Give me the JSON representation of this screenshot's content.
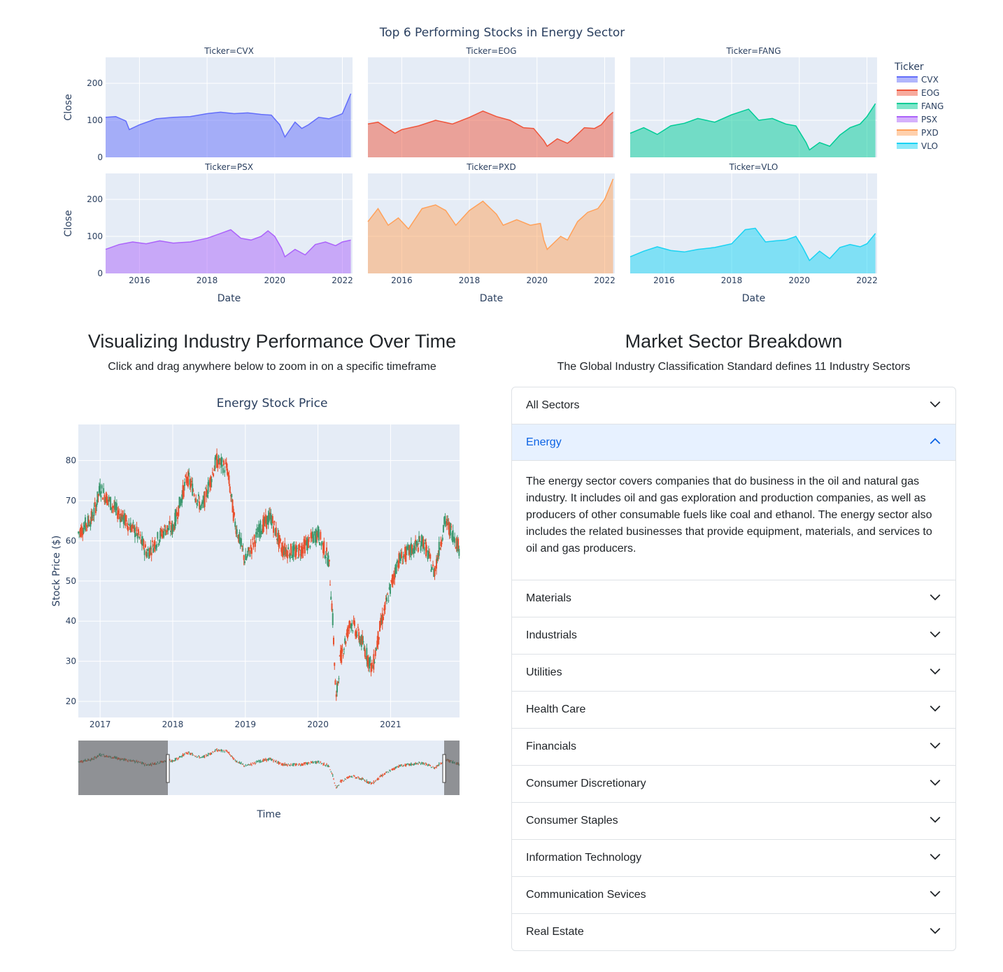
{
  "top": {
    "title": "Top 6 Performing Stocks in Energy Sector",
    "y_axis_label": "Close",
    "x_axis_label": "Date",
    "legend_title": "Ticker"
  },
  "left": {
    "title": "Visualizing Industry Performance Over Time",
    "subtitle": "Click and drag anywhere below to zoom in on a specific timeframe"
  },
  "right": {
    "title": "Market Sector Breakdown",
    "subtitle": "The Global Industry Classification Standard defines 11 Industry Sectors"
  },
  "accordion": {
    "items": [
      {
        "label": "All Sectors",
        "open": false
      },
      {
        "label": "Energy",
        "open": true,
        "body": "The energy sector covers companies that do business in the oil and natural gas industry. It includes oil and gas exploration and production companies, as well as producers of other consumable fuels like coal and ethanol. The energy sector also includes the related businesses that provide equipment, materials, and services to oil and gas producers."
      },
      {
        "label": "Materials",
        "open": false
      },
      {
        "label": "Industrials",
        "open": false
      },
      {
        "label": "Utilities",
        "open": false
      },
      {
        "label": "Health Care",
        "open": false
      },
      {
        "label": "Financials",
        "open": false
      },
      {
        "label": "Consumer Discretionary",
        "open": false
      },
      {
        "label": "Consumer Staples",
        "open": false
      },
      {
        "label": "Information Technology",
        "open": false
      },
      {
        "label": "Communication Sevices",
        "open": false
      },
      {
        "label": "Real Estate",
        "open": false
      }
    ]
  },
  "colors": {
    "plot_bg": "#e5ecf6",
    "accent_blue": "#0c63e4",
    "increasing": "#3d9970",
    "decreasing": "#e8502e"
  },
  "chart_data": [
    {
      "type": "area",
      "title": "Top 6 Performing Stocks in Energy Sector",
      "xlabel": "Date",
      "ylabel": "Close",
      "ylim": [
        0,
        270
      ],
      "xlim": [
        2015.0,
        2022.3
      ],
      "x_ticks": [
        "2016",
        "2018",
        "2020",
        "2022"
      ],
      "y_ticks": [
        "0",
        "100",
        "200"
      ],
      "legend_title": "Ticker",
      "legend_position": "right",
      "series": [
        {
          "name": "CVX",
          "subplot_title": "Ticker=CVX",
          "color": "#636efa",
          "x": [
            2015.0,
            2015.3,
            2015.6,
            2015.7,
            2016.0,
            2016.5,
            2017.0,
            2017.5,
            2018.0,
            2018.4,
            2018.8,
            2019.2,
            2019.6,
            2019.9,
            2020.15,
            2020.3,
            2020.6,
            2020.8,
            2021.0,
            2021.3,
            2021.6,
            2021.9,
            2022.0,
            2022.15,
            2022.25
          ],
          "y": [
            108,
            110,
            98,
            75,
            88,
            104,
            108,
            110,
            118,
            122,
            118,
            120,
            116,
            114,
            88,
            55,
            95,
            78,
            88,
            108,
            104,
            114,
            118,
            150,
            172
          ]
        },
        {
          "name": "EOG",
          "subplot_title": "Ticker=EOG",
          "color": "#ef553b",
          "x": [
            2015.0,
            2015.3,
            2015.8,
            2016.0,
            2016.5,
            2017.0,
            2017.5,
            2018.0,
            2018.4,
            2018.8,
            2019.2,
            2019.6,
            2019.9,
            2020.2,
            2020.3,
            2020.6,
            2020.9,
            2021.0,
            2021.4,
            2021.7,
            2021.9,
            2022.1,
            2022.25
          ],
          "y": [
            90,
            95,
            65,
            75,
            85,
            100,
            90,
            108,
            125,
            110,
            100,
            80,
            78,
            45,
            30,
            50,
            38,
            45,
            80,
            78,
            88,
            110,
            122
          ]
        },
        {
          "name": "FANG",
          "subplot_title": "Ticker=FANG",
          "color": "#00cc96",
          "x": [
            2015.0,
            2015.4,
            2015.8,
            2016.2,
            2016.6,
            2017.0,
            2017.5,
            2018.0,
            2018.5,
            2018.8,
            2019.2,
            2019.6,
            2019.9,
            2020.2,
            2020.3,
            2020.6,
            2020.9,
            2021.2,
            2021.5,
            2021.8,
            2022.0,
            2022.25
          ],
          "y": [
            65,
            80,
            62,
            85,
            92,
            105,
            95,
            115,
            130,
            100,
            105,
            90,
            85,
            40,
            20,
            40,
            30,
            60,
            80,
            90,
            110,
            145
          ]
        },
        {
          "name": "PSX",
          "subplot_title": "Ticker=PSX",
          "color": "#ab63fa",
          "x": [
            2015.0,
            2015.4,
            2015.8,
            2016.2,
            2016.6,
            2017.0,
            2017.5,
            2018.0,
            2018.4,
            2018.7,
            2019.0,
            2019.3,
            2019.6,
            2019.8,
            2020.0,
            2020.2,
            2020.3,
            2020.6,
            2020.9,
            2021.2,
            2021.5,
            2021.8,
            2022.0,
            2022.25
          ],
          "y": [
            65,
            78,
            85,
            80,
            88,
            82,
            85,
            95,
            108,
            118,
            95,
            90,
            100,
            115,
            100,
            68,
            45,
            65,
            50,
            78,
            85,
            75,
            85,
            90
          ]
        },
        {
          "name": "PXD",
          "subplot_title": "Ticker=PXD",
          "color": "#ffa15a",
          "x": [
            2015.0,
            2015.3,
            2015.6,
            2015.9,
            2016.2,
            2016.6,
            2017.0,
            2017.3,
            2017.6,
            2018.0,
            2018.4,
            2018.8,
            2019.0,
            2019.4,
            2019.8,
            2020.1,
            2020.2,
            2020.3,
            2020.7,
            2020.9,
            2021.2,
            2021.5,
            2021.8,
            2022.0,
            2022.25
          ],
          "y": [
            140,
            175,
            130,
            150,
            120,
            175,
            185,
            170,
            130,
            170,
            195,
            160,
            130,
            145,
            130,
            135,
            90,
            65,
            100,
            90,
            140,
            165,
            175,
            200,
            255
          ]
        },
        {
          "name": "VLO",
          "subplot_title": "Ticker=VLO",
          "color": "#19d3f3",
          "x": [
            2015.0,
            2015.4,
            2015.8,
            2016.2,
            2016.6,
            2017.0,
            2017.5,
            2018.0,
            2018.4,
            2018.7,
            2019.0,
            2019.3,
            2019.6,
            2019.9,
            2020.1,
            2020.3,
            2020.6,
            2020.9,
            2021.2,
            2021.5,
            2021.8,
            2022.0,
            2022.25
          ],
          "y": [
            45,
            60,
            72,
            62,
            58,
            65,
            70,
            80,
            118,
            122,
            85,
            88,
            90,
            100,
            70,
            35,
            60,
            40,
            70,
            78,
            72,
            80,
            108
          ]
        }
      ]
    },
    {
      "type": "candlestick",
      "title": "Energy Stock Price",
      "xlabel": "Time",
      "ylabel": "Stock Price ($)",
      "ylim": [
        16,
        89
      ],
      "xlim": [
        2016.7,
        2021.95
      ],
      "x_ticks": [
        "2017",
        "2018",
        "2019",
        "2020",
        "2021"
      ],
      "y_ticks": [
        "20",
        "30",
        "40",
        "50",
        "60",
        "70",
        "80"
      ],
      "rangeslider": true,
      "x": [
        2016.7,
        2016.9,
        2017.0,
        2017.2,
        2017.5,
        2017.65,
        2017.9,
        2018.0,
        2018.2,
        2018.4,
        2018.6,
        2018.75,
        2018.85,
        2019.0,
        2019.2,
        2019.35,
        2019.5,
        2019.7,
        2019.9,
        2020.0,
        2020.15,
        2020.2,
        2020.25,
        2020.3,
        2020.45,
        2020.6,
        2020.75,
        2020.85,
        2020.95,
        2021.1,
        2021.3,
        2021.45,
        2021.6,
        2021.75,
        2021.85,
        2021.95
      ],
      "y": [
        62,
        66,
        73,
        68,
        62,
        57,
        63,
        63,
        76,
        68,
        80,
        78,
        65,
        55,
        63,
        66,
        58,
        57,
        60,
        62,
        55,
        42,
        20,
        30,
        40,
        35,
        28,
        38,
        45,
        55,
        58,
        60,
        52,
        65,
        62,
        58
      ]
    }
  ]
}
